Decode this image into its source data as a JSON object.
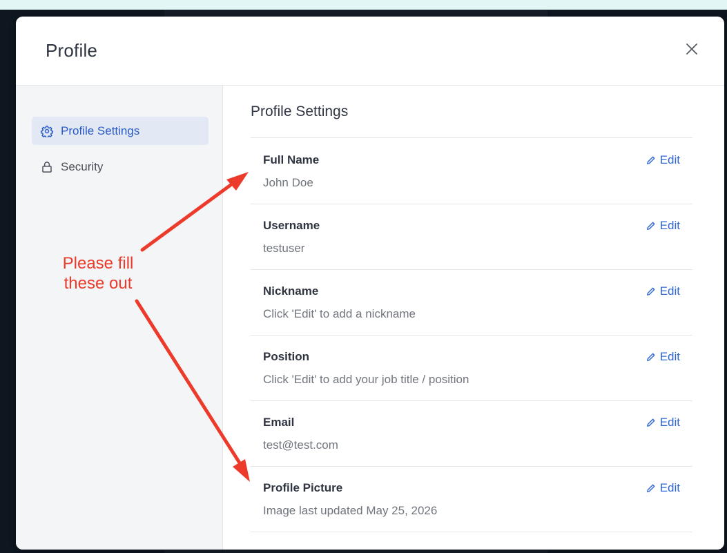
{
  "modal": {
    "title": "Profile",
    "close_icon": "close-icon"
  },
  "sidebar": {
    "items": [
      {
        "label": "Profile Settings",
        "icon": "gear-icon",
        "active": true
      },
      {
        "label": "Security",
        "icon": "lock-icon",
        "active": false
      }
    ]
  },
  "main": {
    "section_title": "Profile Settings",
    "edit_label": "Edit",
    "fields": [
      {
        "label": "Full Name",
        "value": "John Doe"
      },
      {
        "label": "Username",
        "value": "testuser"
      },
      {
        "label": "Nickname",
        "value": "Click 'Edit' to add a nickname"
      },
      {
        "label": "Position",
        "value": "Click 'Edit' to add your job title / position"
      },
      {
        "label": "Email",
        "value": "test@test.com"
      },
      {
        "label": "Profile Picture",
        "value": "Image last updated May 25, 2026"
      }
    ]
  },
  "annotation": {
    "line1": "Please fill",
    "line2": "these out",
    "color": "#ec3a2b"
  },
  "colors": {
    "accent": "#2e66d4",
    "active_bg": "#e2e8f4"
  }
}
